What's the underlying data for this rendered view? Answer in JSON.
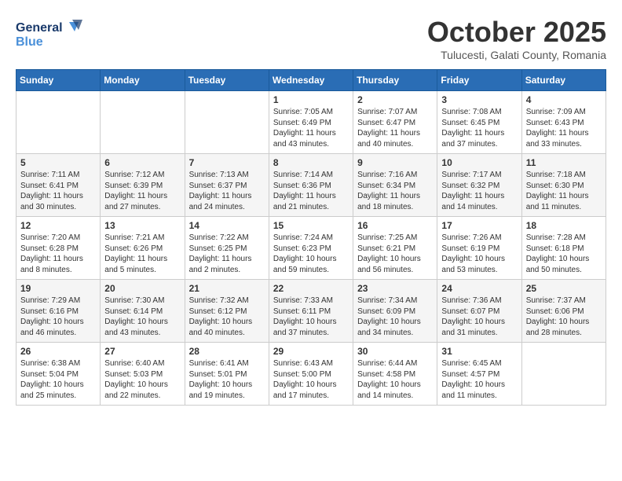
{
  "header": {
    "logo_general": "General",
    "logo_blue": "Blue",
    "title": "October 2025",
    "location": "Tulucesti, Galati County, Romania"
  },
  "weekdays": [
    "Sunday",
    "Monday",
    "Tuesday",
    "Wednesday",
    "Thursday",
    "Friday",
    "Saturday"
  ],
  "weeks": [
    [
      {
        "day": "",
        "info": ""
      },
      {
        "day": "",
        "info": ""
      },
      {
        "day": "",
        "info": ""
      },
      {
        "day": "1",
        "info": "Sunrise: 7:05 AM\nSunset: 6:49 PM\nDaylight: 11 hours and 43 minutes."
      },
      {
        "day": "2",
        "info": "Sunrise: 7:07 AM\nSunset: 6:47 PM\nDaylight: 11 hours and 40 minutes."
      },
      {
        "day": "3",
        "info": "Sunrise: 7:08 AM\nSunset: 6:45 PM\nDaylight: 11 hours and 37 minutes."
      },
      {
        "day": "4",
        "info": "Sunrise: 7:09 AM\nSunset: 6:43 PM\nDaylight: 11 hours and 33 minutes."
      }
    ],
    [
      {
        "day": "5",
        "info": "Sunrise: 7:11 AM\nSunset: 6:41 PM\nDaylight: 11 hours and 30 minutes."
      },
      {
        "day": "6",
        "info": "Sunrise: 7:12 AM\nSunset: 6:39 PM\nDaylight: 11 hours and 27 minutes."
      },
      {
        "day": "7",
        "info": "Sunrise: 7:13 AM\nSunset: 6:37 PM\nDaylight: 11 hours and 24 minutes."
      },
      {
        "day": "8",
        "info": "Sunrise: 7:14 AM\nSunset: 6:36 PM\nDaylight: 11 hours and 21 minutes."
      },
      {
        "day": "9",
        "info": "Sunrise: 7:16 AM\nSunset: 6:34 PM\nDaylight: 11 hours and 18 minutes."
      },
      {
        "day": "10",
        "info": "Sunrise: 7:17 AM\nSunset: 6:32 PM\nDaylight: 11 hours and 14 minutes."
      },
      {
        "day": "11",
        "info": "Sunrise: 7:18 AM\nSunset: 6:30 PM\nDaylight: 11 hours and 11 minutes."
      }
    ],
    [
      {
        "day": "12",
        "info": "Sunrise: 7:20 AM\nSunset: 6:28 PM\nDaylight: 11 hours and 8 minutes."
      },
      {
        "day": "13",
        "info": "Sunrise: 7:21 AM\nSunset: 6:26 PM\nDaylight: 11 hours and 5 minutes."
      },
      {
        "day": "14",
        "info": "Sunrise: 7:22 AM\nSunset: 6:25 PM\nDaylight: 11 hours and 2 minutes."
      },
      {
        "day": "15",
        "info": "Sunrise: 7:24 AM\nSunset: 6:23 PM\nDaylight: 10 hours and 59 minutes."
      },
      {
        "day": "16",
        "info": "Sunrise: 7:25 AM\nSunset: 6:21 PM\nDaylight: 10 hours and 56 minutes."
      },
      {
        "day": "17",
        "info": "Sunrise: 7:26 AM\nSunset: 6:19 PM\nDaylight: 10 hours and 53 minutes."
      },
      {
        "day": "18",
        "info": "Sunrise: 7:28 AM\nSunset: 6:18 PM\nDaylight: 10 hours and 50 minutes."
      }
    ],
    [
      {
        "day": "19",
        "info": "Sunrise: 7:29 AM\nSunset: 6:16 PM\nDaylight: 10 hours and 46 minutes."
      },
      {
        "day": "20",
        "info": "Sunrise: 7:30 AM\nSunset: 6:14 PM\nDaylight: 10 hours and 43 minutes."
      },
      {
        "day": "21",
        "info": "Sunrise: 7:32 AM\nSunset: 6:12 PM\nDaylight: 10 hours and 40 minutes."
      },
      {
        "day": "22",
        "info": "Sunrise: 7:33 AM\nSunset: 6:11 PM\nDaylight: 10 hours and 37 minutes."
      },
      {
        "day": "23",
        "info": "Sunrise: 7:34 AM\nSunset: 6:09 PM\nDaylight: 10 hours and 34 minutes."
      },
      {
        "day": "24",
        "info": "Sunrise: 7:36 AM\nSunset: 6:07 PM\nDaylight: 10 hours and 31 minutes."
      },
      {
        "day": "25",
        "info": "Sunrise: 7:37 AM\nSunset: 6:06 PM\nDaylight: 10 hours and 28 minutes."
      }
    ],
    [
      {
        "day": "26",
        "info": "Sunrise: 6:38 AM\nSunset: 5:04 PM\nDaylight: 10 hours and 25 minutes."
      },
      {
        "day": "27",
        "info": "Sunrise: 6:40 AM\nSunset: 5:03 PM\nDaylight: 10 hours and 22 minutes."
      },
      {
        "day": "28",
        "info": "Sunrise: 6:41 AM\nSunset: 5:01 PM\nDaylight: 10 hours and 19 minutes."
      },
      {
        "day": "29",
        "info": "Sunrise: 6:43 AM\nSunset: 5:00 PM\nDaylight: 10 hours and 17 minutes."
      },
      {
        "day": "30",
        "info": "Sunrise: 6:44 AM\nSunset: 4:58 PM\nDaylight: 10 hours and 14 minutes."
      },
      {
        "day": "31",
        "info": "Sunrise: 6:45 AM\nSunset: 4:57 PM\nDaylight: 10 hours and 11 minutes."
      },
      {
        "day": "",
        "info": ""
      }
    ]
  ]
}
